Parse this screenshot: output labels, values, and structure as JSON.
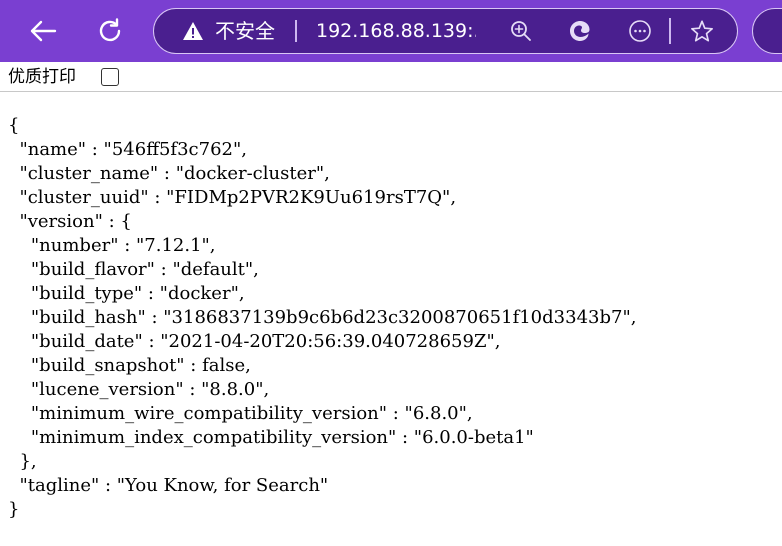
{
  "toolbar": {
    "security_label": "不安全",
    "url": "192.168.88.139:..."
  },
  "pretty_print": {
    "label": "优质打印",
    "checked": false
  },
  "json_lines": [
    "{",
    "  \"name\" : \"546ff5f3c762\",",
    "  \"cluster_name\" : \"docker-cluster\",",
    "  \"cluster_uuid\" : \"FIDMp2PVR2K9Uu619rsT7Q\",",
    "  \"version\" : {",
    "    \"number\" : \"7.12.1\",",
    "    \"build_flavor\" : \"default\",",
    "    \"build_type\" : \"docker\",",
    "    \"build_hash\" : \"3186837139b9c6b6d23c3200870651f10d3343b7\",",
    "    \"build_date\" : \"2021-04-20T20:56:39.040728659Z\",",
    "    \"build_snapshot\" : false,",
    "    \"lucene_version\" : \"8.8.0\",",
    "    \"minimum_wire_compatibility_version\" : \"6.8.0\",",
    "    \"minimum_index_compatibility_version\" : \"6.0.0-beta1\"",
    "  },",
    "  \"tagline\" : \"You Know, for Search\"",
    "}"
  ],
  "colors": {
    "toolbar_bg": "#7a3fd1",
    "address_bg": "#4a1f8f"
  },
  "icons": [
    "back-arrow-icon",
    "reload-icon",
    "warning-icon",
    "zoom-icon",
    "edge-icon",
    "more-icon",
    "favorite-star-icon"
  ]
}
